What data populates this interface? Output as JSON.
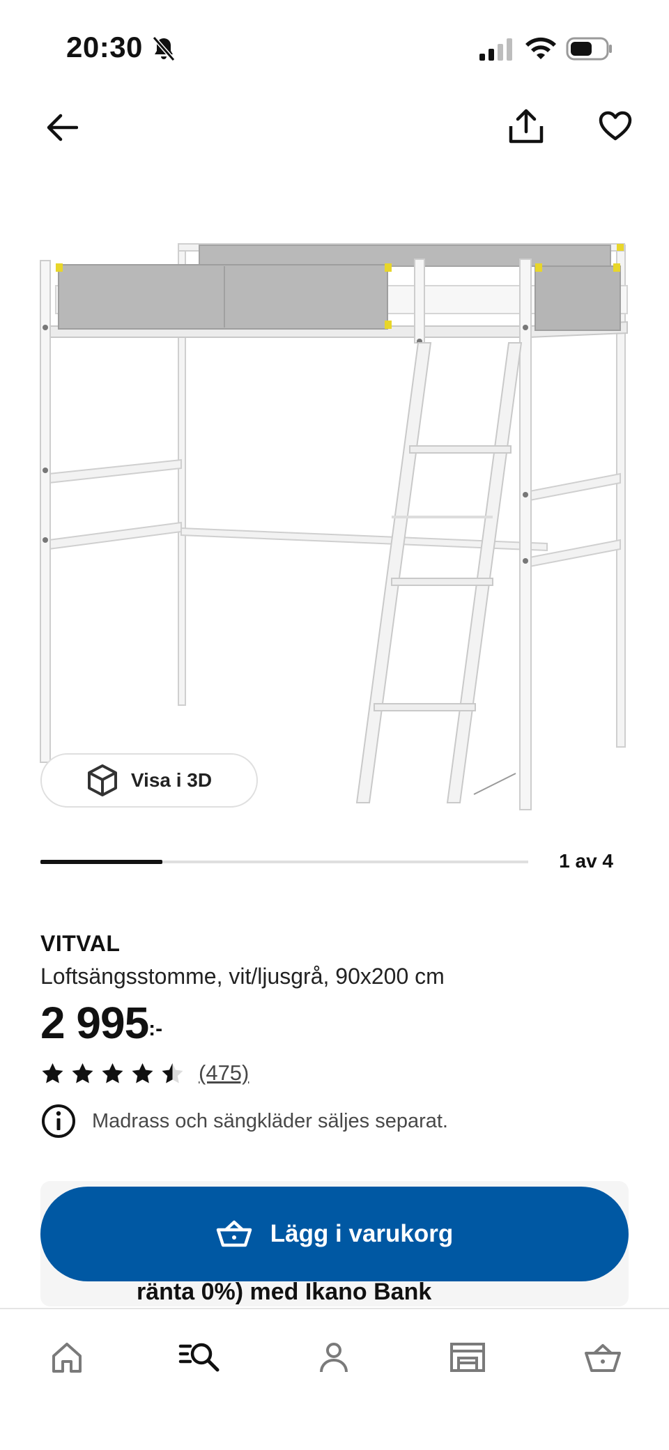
{
  "status_bar": {
    "time": "20:30"
  },
  "gallery": {
    "view_3d_label": "Visa i 3D",
    "pager": "1 av 4",
    "current_image": 1,
    "image_count": 4
  },
  "product": {
    "name": "VITVAL",
    "description": "Loftsängsstomme, vit/ljusgrå, 90x200 cm",
    "price": "2 995",
    "price_suffix": ":-",
    "rating": 4.5,
    "rating_max": 5,
    "review_count": "(475)",
    "notice": "Madrass och sängkläder säljes separat."
  },
  "cart": {
    "add_label": "Lägg i varukorg",
    "promo_text": "ränta 0%) med Ikano Bank"
  },
  "bottom_nav": {
    "tabs": [
      {
        "icon": "home-icon"
      },
      {
        "icon": "search-list-icon",
        "active": true
      },
      {
        "icon": "profile-icon"
      },
      {
        "icon": "store-icon"
      },
      {
        "icon": "cart-icon"
      }
    ]
  },
  "colors": {
    "brand_blue": "#0058a3",
    "text": "#111111",
    "muted": "#484848"
  }
}
